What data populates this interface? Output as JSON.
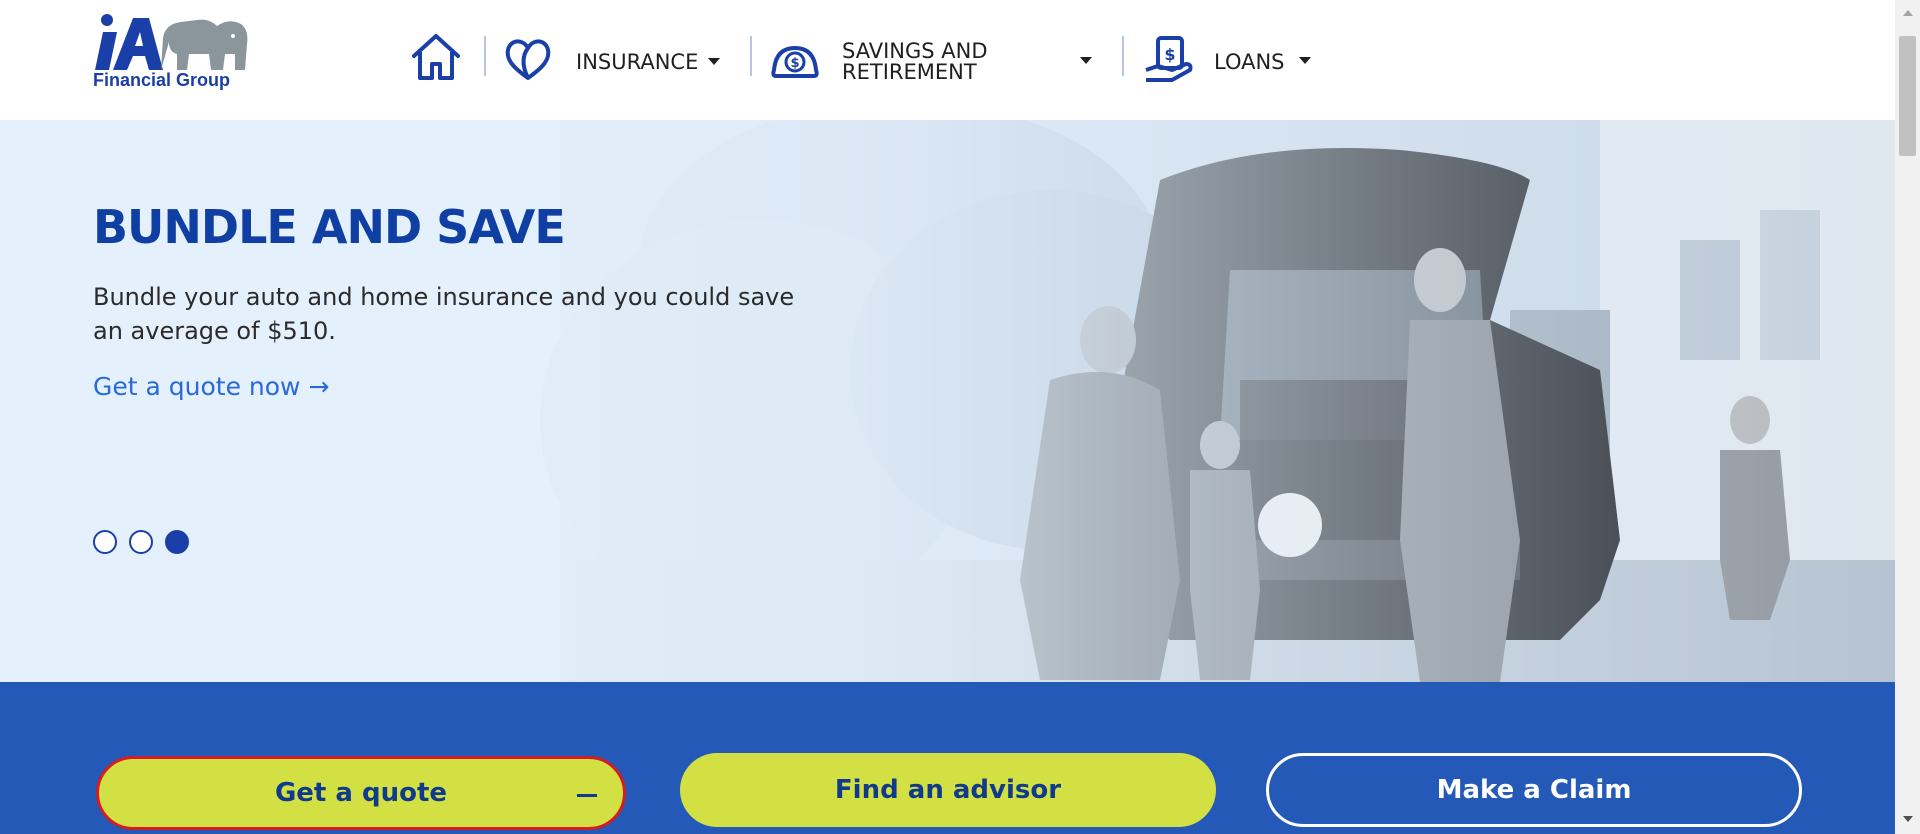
{
  "brand": {
    "logo_text": "Financial Group"
  },
  "nav": {
    "items": [
      {
        "label": "INSURANCE",
        "icon": "heart-icon"
      },
      {
        "label": "SAVINGS AND",
        "label2": "RETIREMENT",
        "icon": "piggy-bank-icon"
      },
      {
        "label": "LOANS",
        "icon": "hand-money-icon"
      }
    ]
  },
  "hero": {
    "title": "BUNDLE AND SAVE",
    "description": "Bundle your auto and home insurance and you could save an average of $510.",
    "cta_text": "Get a quote now →",
    "slide_count": 3,
    "active_slide": 3
  },
  "actions": {
    "quote_label": "Get a quote",
    "advisor_label": "Find an advisor",
    "claim_label": "Make a Claim"
  },
  "colors": {
    "brand_blue": "#1a3fa8",
    "accent_lime": "#d3e044",
    "band_blue": "#2459b8",
    "hero_bg": "#e4f0fb",
    "link_blue": "#2a6ad8",
    "focus_red": "#d31c24"
  }
}
